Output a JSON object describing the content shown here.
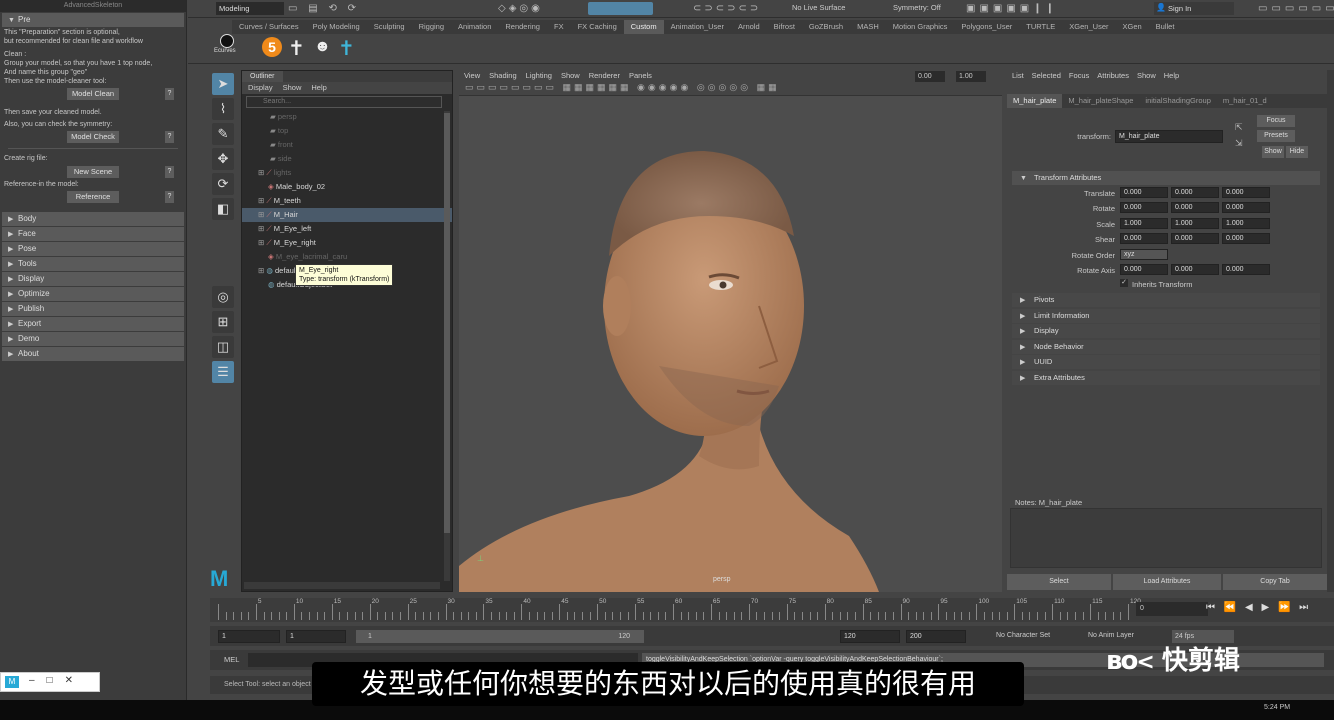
{
  "left_panel": {
    "title": "AdvancedSkeleton",
    "pre_section": "Pre",
    "intro_text": [
      "This \"Preparation\" section is optional,",
      "but recommended for clean file and workflow"
    ],
    "clean_text": [
      "Clean :",
      "Group your model, so that you have 1 top node,",
      "And name this group \"geo\"",
      "Then use the model-cleaner tool:"
    ],
    "model_clean": "Model Clean",
    "save_text": "Then save your cleaned model.",
    "symmetry_text": "Also, you can check the symmetry:",
    "model_check": "Model Check",
    "rig_text": "Create rig file:",
    "new_scene": "New Scene",
    "ref_text": "Reference-in the model:",
    "reference": "Reference",
    "q": "?",
    "sections": [
      "Body",
      "Face",
      "Pose",
      "Tools",
      "Display",
      "Optimize",
      "Publish",
      "Export",
      "Demo",
      "About"
    ]
  },
  "topbar": {
    "mode": "Modeling",
    "live_surface": "No Live Surface",
    "symmetry": "Symmetry: Off",
    "sign_in": "Sign In"
  },
  "shelf_tabs": [
    "Curves / Surfaces",
    "Poly Modeling",
    "Sculpting",
    "Rigging",
    "Animation",
    "Rendering",
    "FX",
    "FX Caching",
    "Custom",
    "Animation_User",
    "Arnold",
    "Bifrost",
    "GoZBrush",
    "MASH",
    "Motion Graphics",
    "Polygons_User",
    "TURTLE",
    "XGen_User",
    "XGen",
    "Bullet"
  ],
  "shelf": {
    "ecurves": "Ecurves",
    "five": "5"
  },
  "outliner": {
    "tab": "Outliner",
    "menu": [
      "Display",
      "Show",
      "Help"
    ],
    "search_placeholder": "Search...",
    "items": [
      {
        "label": "persp",
        "dim": true
      },
      {
        "label": "top",
        "dim": true
      },
      {
        "label": "front",
        "dim": true
      },
      {
        "label": "side",
        "dim": true
      },
      {
        "label": "lights",
        "dim": true
      },
      {
        "label": "Male_body_02",
        "dim": false
      },
      {
        "label": "M_teeth",
        "dim": false
      },
      {
        "label": "M_Hair",
        "dim": false
      },
      {
        "label": "M_Eye_left",
        "dim": false
      },
      {
        "label": "M_Eye_right",
        "dim": false
      },
      {
        "label": "M_eye_lacrimal_caru",
        "dim": true
      },
      {
        "label": "defaultLightSet",
        "dim": false
      },
      {
        "label": "defaultObjectSet",
        "dim": false
      }
    ],
    "tooltip": [
      "M_Eye_right",
      "Type: transform (kTransform)"
    ]
  },
  "viewport": {
    "menu": [
      "View",
      "Shading",
      "Lighting",
      "Show",
      "Renderer",
      "Panels"
    ],
    "val1": "0.00",
    "val2": "1.00",
    "camera": "persp"
  },
  "attr_editor": {
    "menu": [
      "List",
      "Selected",
      "Focus",
      "Attributes",
      "Show",
      "Help"
    ],
    "tabs": [
      "M_hair_plate",
      "M_hair_plateShape",
      "initialShadingGroup",
      "m_hair_01_d"
    ],
    "transform_label": "transform:",
    "transform_value": "M_hair_plate",
    "focus": "Focus",
    "presets": "Presets",
    "show": "Show",
    "hide": "Hide",
    "section_title": "Transform Attributes",
    "translate": {
      "label": "Translate",
      "x": "0.000",
      "y": "0.000",
      "z": "0.000"
    },
    "rotate": {
      "label": "Rotate",
      "x": "0.000",
      "y": "0.000",
      "z": "0.000"
    },
    "scale": {
      "label": "Scale",
      "x": "1.000",
      "y": "1.000",
      "z": "1.000"
    },
    "shear": {
      "label": "Shear",
      "x": "0.000",
      "y": "0.000",
      "z": "0.000"
    },
    "rotate_order": {
      "label": "Rotate Order",
      "value": "xyz"
    },
    "rotate_axis": {
      "label": "Rotate Axis",
      "x": "0.000",
      "y": "0.000",
      "z": "0.000"
    },
    "inherits": "Inherits Transform",
    "collapsed": [
      "Pivots",
      "Limit Information",
      "Display",
      "Node Behavior",
      "UUID",
      "Extra Attributes"
    ],
    "notes": "Notes:  M_hair_plate",
    "select": "Select",
    "load": "Load Attributes",
    "copy": "Copy Tab"
  },
  "timeline": {
    "ticks": [
      "5",
      "10",
      "15",
      "20",
      "25",
      "30",
      "35",
      "40",
      "45",
      "50",
      "55",
      "60",
      "65",
      "70",
      "75",
      "80",
      "85",
      "90",
      "95",
      "100",
      "105",
      "110",
      "115",
      "120"
    ],
    "current": "0"
  },
  "range": {
    "start": "1",
    "start2": "1",
    "bar_start": "1",
    "bar_end": "120",
    "end": "120",
    "end2": "200",
    "char_set": "No Character Set",
    "anim_layer": "No Anim Layer",
    "fps": "24 fps"
  },
  "mel": {
    "label": "MEL",
    "output": "toggleVisibilityAndKeepSelection `optionVar -query toggleVisibilityAndKeepSelectionBehaviour`;"
  },
  "help_line": "Select Tool: select an object",
  "subtitle": "发型或任何你想要的东西对以后的使用真的很有用",
  "watermark": "快剪辑",
  "clock": "5:24 PM"
}
